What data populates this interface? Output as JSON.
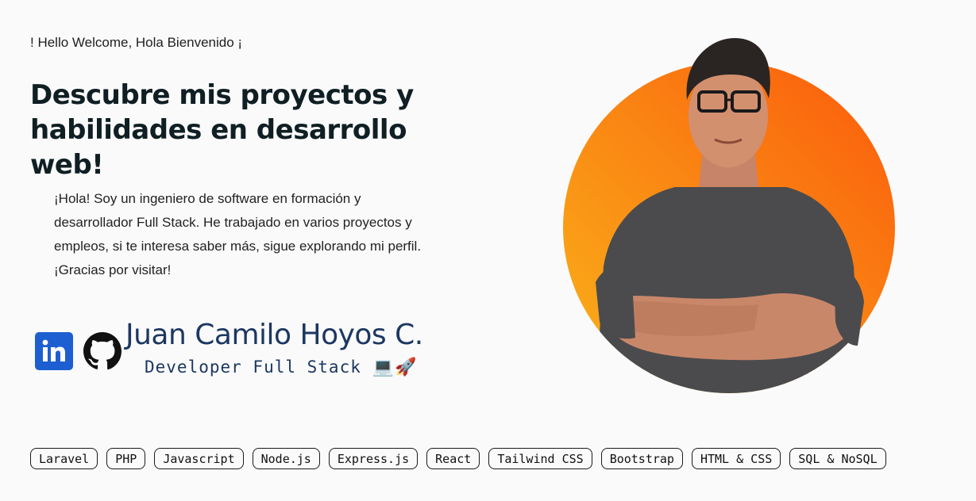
{
  "hero": {
    "greeting": "! Hello Welcome, Hola Bienvenido ¡",
    "headline": "Descubre mis proyectos y habilidades en desarrollo web!",
    "intro": "¡Hola! Soy un ingeniero de software en formación y desarrollador Full Stack. He trabajado en varios proyectos y empleos, si te interesa saber más, sigue explorando mi perfil. ¡Gracias por visitar!"
  },
  "profile": {
    "name": "Juan Camilo Hoyos C.",
    "role": "Developer Full Stack",
    "role_emoji": "💻🚀"
  },
  "social": {
    "linkedin_icon": "linkedin-icon",
    "github_icon": "github-icon"
  },
  "tags": [
    "Laravel",
    "PHP",
    "Javascript",
    "Node.js",
    "Express.js",
    "React",
    "Tailwind CSS",
    "Bootstrap",
    "HTML & CSS",
    "SQL & NoSQL"
  ],
  "colors": {
    "headline": "#0f1f23",
    "name": "#1c3761",
    "linkedin": "#1d5fd1",
    "circle_start": "#f9b21a",
    "circle_end": "#fb5a0c"
  }
}
